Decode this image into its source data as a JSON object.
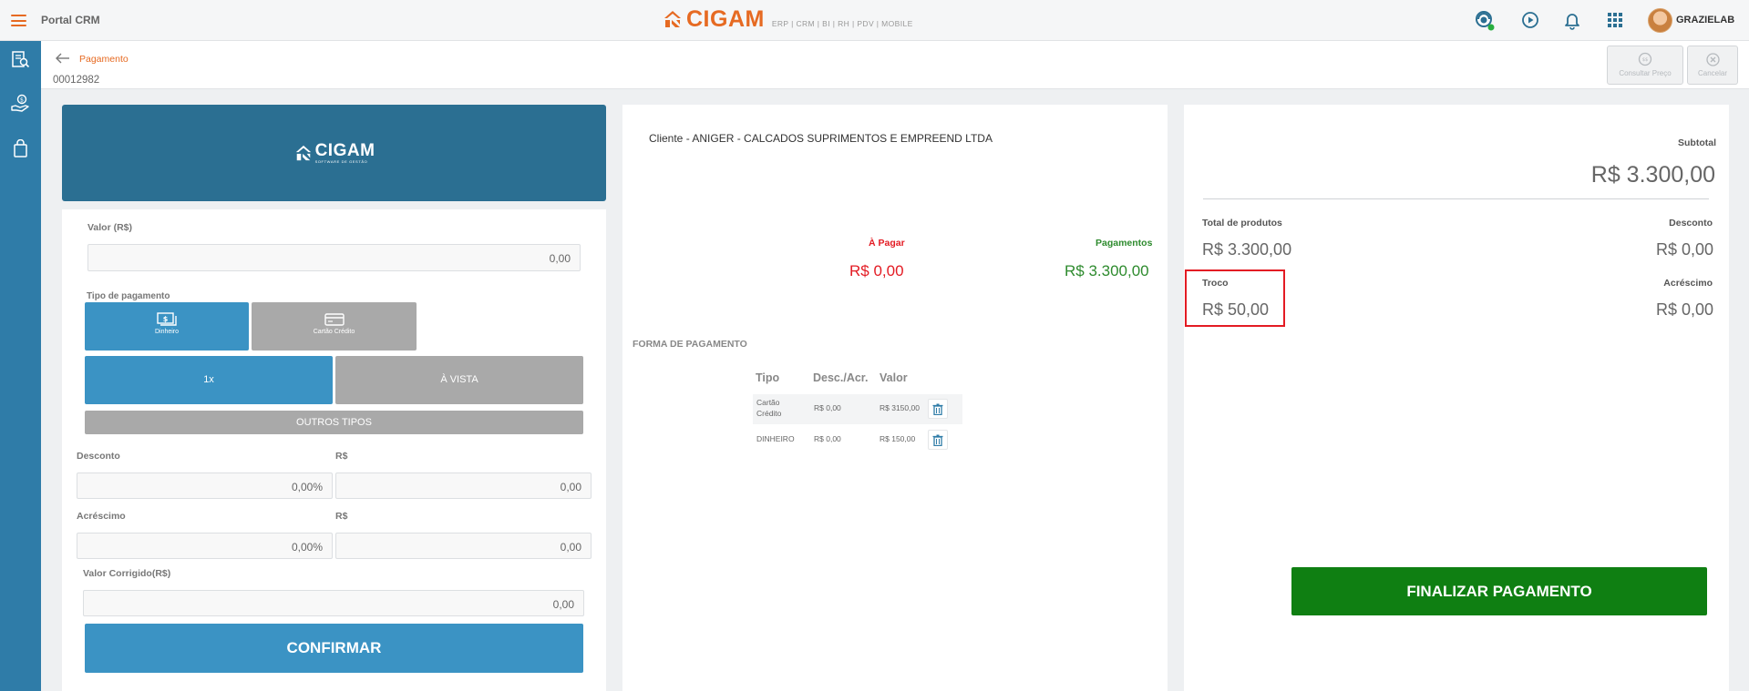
{
  "header": {
    "portal_title": "Portal CRM",
    "brand_name": "CIGAM",
    "brand_tagline": "ERP | CRM | BI | RH | PDV | MOBILE",
    "user_name": "GRAZIELAB"
  },
  "subheader": {
    "breadcrumb": "Pagamento",
    "doc_code": "00012982",
    "consultar_preco": "Consultar Preço",
    "cancelar": "Cancelar"
  },
  "left": {
    "banner_name": "CIGAM",
    "banner_sub": "SOFTWARE DE GESTÃO",
    "valor_label": "Valor (R$)",
    "valor_value": "0,00",
    "tipo_label": "Tipo de pagamento",
    "tipo_dinheiro": "Dinheiro",
    "tipo_cartao": "Cartão Crédito",
    "parcela_1x": "1x",
    "parcela_vista": "À VISTA",
    "outros_tipos": "OUTROS TIPOS",
    "desconto_label": "Desconto",
    "desconto_rs_label": "R$",
    "desconto_pct": "0,00%",
    "desconto_rs": "0,00",
    "acrescimo_label": "Acréscimo",
    "acrescimo_rs_label": "R$",
    "acrescimo_pct": "0,00%",
    "acrescimo_rs": "0,00",
    "corrigido_label": "Valor Corrigido(R$)",
    "corrigido_value": "0,00",
    "confirmar": "CONFIRMAR"
  },
  "middle": {
    "cliente": "Cliente - ANIGER - CALCADOS SUPRIMENTOS E EMPREEND LTDA",
    "a_pagar_label": "À Pagar",
    "a_pagar_value": "R$ 0,00",
    "pagamentos_label": "Pagamentos",
    "pagamentos_value": "R$ 3.300,00",
    "forma_title": "FORMA DE PAGAMENTO",
    "columns": [
      "Tipo",
      "Desc./Acr.",
      "Valor"
    ],
    "rows": [
      {
        "tipo": "Cartão Crédito",
        "desc": "R$ 0,00",
        "valor": "R$ 3150,00"
      },
      {
        "tipo": "DINHEIRO",
        "desc": "R$ 0,00",
        "valor": "R$ 150,00"
      }
    ]
  },
  "right": {
    "subtotal_label": "Subtotal",
    "subtotal_value": "R$ 3.300,00",
    "total_produtos_label": "Total de produtos",
    "total_produtos_value": "R$ 3.300,00",
    "desconto_label": "Desconto",
    "desconto_value": "R$ 0,00",
    "troco_label": "Troco",
    "troco_value": "R$ 50,00",
    "acrescimo_label": "Acréscimo",
    "acrescimo_value": "R$ 0,00",
    "finalizar": "FINALIZAR PAGAMENTO"
  },
  "colors": {
    "accent_orange": "#e66a22",
    "sidebar_blue": "#2f7ca8",
    "button_blue": "#3b93c4",
    "a_pagar_red": "#e31b23",
    "pagamentos_green": "#2e8b2e",
    "finalizar_green": "#0f7f12"
  }
}
